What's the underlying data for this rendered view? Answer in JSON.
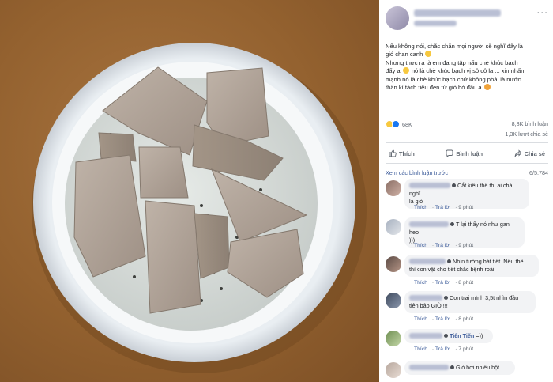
{
  "post": {
    "more_label": "...",
    "text_lines": [
      "Nếu không nói, chắc chắn mọi người sẽ nghĩ đây là",
      "gió chan canh",
      "Nhưng thực ra là em đang tập nấu chè khúc bạch",
      "đấy a",
      "nó là chè khúc bạch vị sô cô la ... xin nhấn",
      "mạnh nó là chè khúc bạch chứ không phải là nước",
      "thần kì tách tiêu đen từ giò bò đâu a"
    ],
    "reaction_count": "68K",
    "comments_count": "8,8K bình luận",
    "shares_count": "1,3K lượt chia sẻ"
  },
  "actions": {
    "like": "Thích",
    "comment": "Bình luận",
    "share": "Chia sẻ"
  },
  "comments_bar": {
    "more": "Xem các bình luận trước",
    "count": "6/5.784"
  },
  "comment_meta": {
    "like": "Thích",
    "reply": "Trả lời"
  },
  "comments": [
    {
      "line1": "Cắt kiểu thế thì ai chả nghĩ",
      "line2": "là giò",
      "time": "9 phút"
    },
    {
      "line1": "T lại thấy nó như gan heo",
      "line2": ")))",
      "time": "9 phút"
    },
    {
      "line1": "Nhìn tưởng bát tiết. Nếu thế",
      "line2": "thì con vật cho tiết chắc bệnh roài",
      "time": "8 phút"
    },
    {
      "line1": "Con trai mình 3,5t nhìn đầu",
      "line2": "tiên bảo GIÒ !!!",
      "time": "8 phút"
    },
    {
      "line1": "Tiến Tiến",
      "line1b": "=))",
      "line2": "",
      "time": "7 phút"
    },
    {
      "line1": "Giò hơi nhiều bột",
      "line2": "",
      "time": ""
    }
  ],
  "colors": {
    "link": "#385898",
    "meta": "#606770",
    "bubble": "#f2f3f5",
    "table": "#93612f"
  }
}
